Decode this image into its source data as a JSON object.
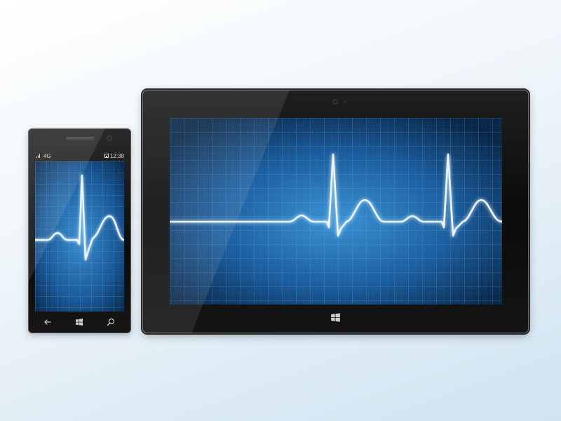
{
  "phone": {
    "status": {
      "network": "4G",
      "time": "12:38"
    },
    "nav": {
      "back_icon": "back-arrow-icon",
      "start_icon": "windows-start-icon",
      "search_icon": "search-icon"
    }
  },
  "tablet": {
    "start_icon": "windows-start-icon"
  },
  "colors": {
    "screen_dark": "#0a2a4e",
    "screen_light": "#2f7fc3",
    "grid_line": "#5aa3d9",
    "ecg_trace": "#e9f6ff",
    "ecg_glow": "#9fd4ff"
  }
}
